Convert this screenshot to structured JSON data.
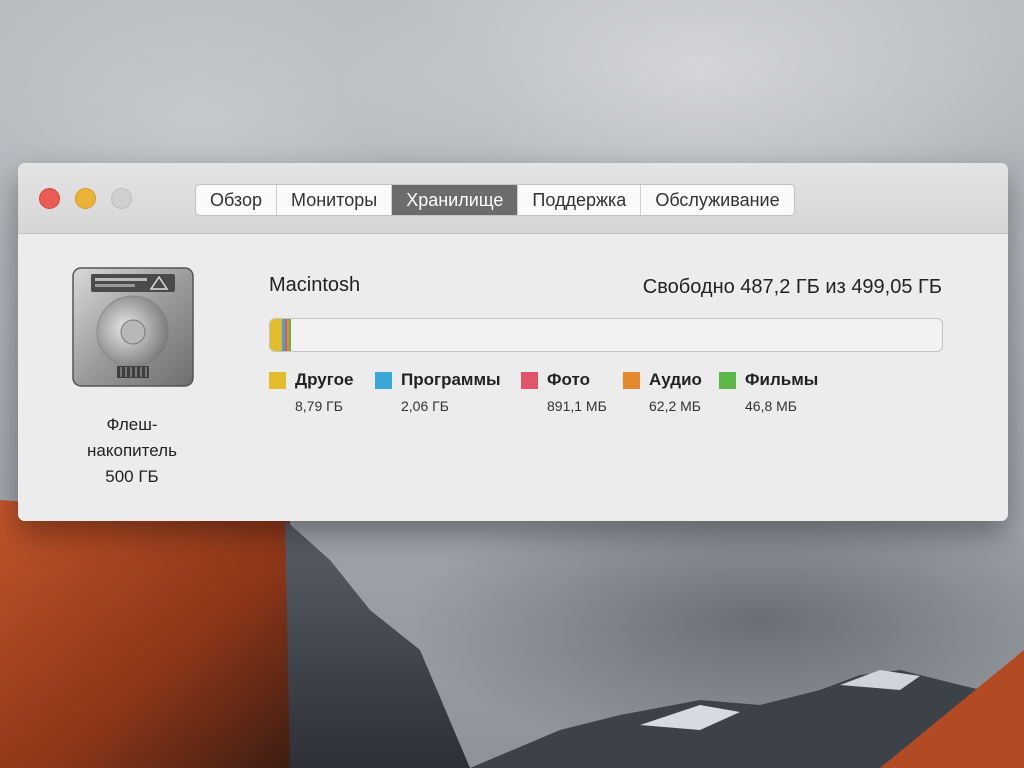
{
  "window": {
    "tabs": [
      {
        "label": "Обзор",
        "active": false
      },
      {
        "label": "Мониторы",
        "active": false
      },
      {
        "label": "Хранилище",
        "active": true
      },
      {
        "label": "Поддержка",
        "active": false
      },
      {
        "label": "Обслуживание",
        "active": false
      }
    ]
  },
  "disk": {
    "label_line1": "Флеш-",
    "label_line2": "накопитель",
    "label_line3": "500 ГБ"
  },
  "volume": {
    "name": "Macintosh",
    "free_text": "Свободно 487,2 ГБ из 499,05 ГБ",
    "categories": [
      {
        "name": "Другое",
        "size": "8,79 ГБ",
        "color": "#e2bc2a",
        "fraction": 0.0176
      },
      {
        "name": "Программы",
        "size": "2,06 ГБ",
        "color": "#3aa7d8",
        "fraction": 0.0041
      },
      {
        "name": "Фото",
        "size": "891,1 МБ",
        "color": "#e2546a",
        "fraction": 0.0018
      },
      {
        "name": "Аудио",
        "size": "62,2 МБ",
        "color": "#e58a2c",
        "fraction": 0.0001
      },
      {
        "name": "Фильмы",
        "size": "46,8 МБ",
        "color": "#5cb846",
        "fraction": 0.0001
      }
    ]
  }
}
